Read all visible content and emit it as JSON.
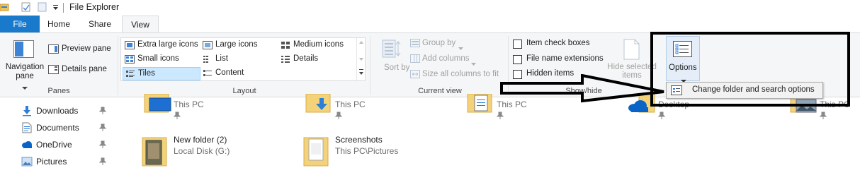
{
  "titlebar": {
    "title": "File Explorer",
    "icons": [
      "folder-icon",
      "properties-icon",
      "new-folder-icon",
      "customize-dropdown-icon"
    ]
  },
  "tabs": [
    {
      "label": "File",
      "state": "file"
    },
    {
      "label": "Home",
      "state": "normal"
    },
    {
      "label": "Share",
      "state": "normal"
    },
    {
      "label": "View",
      "state": "active"
    }
  ],
  "panes": {
    "navigation_pane": "Navigation pane",
    "preview_pane": "Preview pane",
    "details_pane": "Details pane",
    "group_label": "Panes"
  },
  "layout": {
    "items": [
      {
        "label": "Extra large icons",
        "icon": "extra-large-icons-icon",
        "selected": false
      },
      {
        "label": "Large icons",
        "icon": "large-icons-icon",
        "selected": false
      },
      {
        "label": "Medium icons",
        "icon": "medium-icons-icon",
        "selected": false
      },
      {
        "label": "Small icons",
        "icon": "small-icons-icon",
        "selected": false
      },
      {
        "label": "List",
        "icon": "list-icon",
        "selected": false
      },
      {
        "label": "Details",
        "icon": "details-icon",
        "selected": false
      },
      {
        "label": "Tiles",
        "icon": "tiles-icon",
        "selected": true
      },
      {
        "label": "Content",
        "icon": "content-icon",
        "selected": false
      }
    ],
    "group_label": "Layout"
  },
  "current_view": {
    "sort_by": "Sort by",
    "group_by": "Group by",
    "add_columns": "Add columns",
    "size_columns": "Size all columns to fit",
    "group_label": "Current view"
  },
  "show_hide": {
    "item_checkboxes": {
      "label": "Item check boxes",
      "checked": false
    },
    "file_name_extensions": {
      "label": "File name extensions",
      "checked": false
    },
    "hidden_items": {
      "label": "Hidden items",
      "checked": false
    },
    "hide_selected": "Hide selected items",
    "group_label": "Show/hide"
  },
  "options": {
    "label": "Options",
    "popup_item": "Change folder and search options"
  },
  "nav_pane": [
    {
      "label": "Downloads",
      "icon": "downloads-icon"
    },
    {
      "label": "Documents",
      "icon": "documents-icon"
    },
    {
      "label": "OneDrive",
      "icon": "onedrive-icon"
    },
    {
      "label": "Pictures",
      "icon": "pictures-icon"
    }
  ],
  "tiles_row1": [
    {
      "sub": "This PC",
      "icon": "desktop-folder-icon"
    },
    {
      "sub": "This PC",
      "icon": "downloads-folder-icon"
    },
    {
      "sub": "This PC",
      "icon": "documents-folder-icon"
    },
    {
      "sub": "Desktop",
      "icon": "onedrive-folder-icon"
    },
    {
      "sub": "This PC",
      "icon": "pictures-folder-icon"
    }
  ],
  "tiles_row2": [
    {
      "name": "New folder (2)",
      "sub": "Local Disk (G:)",
      "icon": "folder-icon"
    },
    {
      "name": "Screenshots",
      "sub": "This PC\\Pictures",
      "icon": "folder-icon"
    }
  ],
  "colors": {
    "accent": "#1979ca",
    "selection": "#cce8ff",
    "folder": "#f0c35a"
  }
}
